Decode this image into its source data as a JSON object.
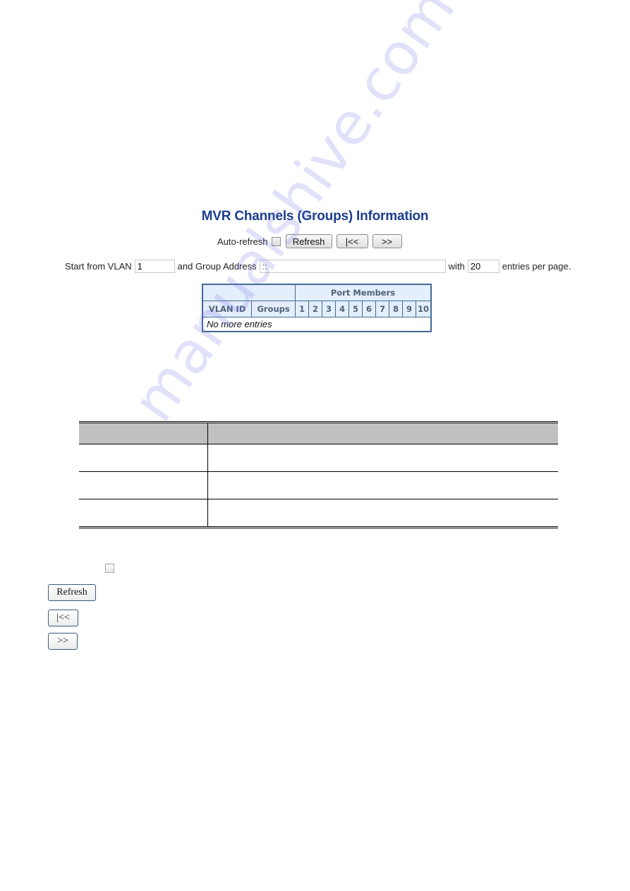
{
  "screenshot": {
    "title": "MVR Channels (Groups) Information",
    "toolbar": {
      "auto_refresh_label": "Auto-refresh",
      "auto_refresh_checked": false,
      "refresh_label": "Refresh",
      "first_page_label": "|<<",
      "next_page_label": ">>"
    },
    "filter": {
      "start_label": "Start from VLAN",
      "vlan_value": "1",
      "group_label": "and Group Address",
      "group_value": "::",
      "with_label": "with",
      "entries_value": "20",
      "entries_suffix": "entries per page."
    },
    "table": {
      "port_members_header": "Port Members",
      "columns": [
        "VLAN ID",
        "Groups"
      ],
      "ports": [
        "1",
        "2",
        "3",
        "4",
        "5",
        "6",
        "7",
        "8",
        "9",
        "10"
      ],
      "empty_message": "No more entries"
    }
  },
  "doc_table": {
    "rows": 3
  },
  "legacy_buttons": {
    "refresh_label": "Refresh",
    "first_page_label": "|<<",
    "next_page_label": ">>"
  },
  "watermark": "manualshive.com"
}
